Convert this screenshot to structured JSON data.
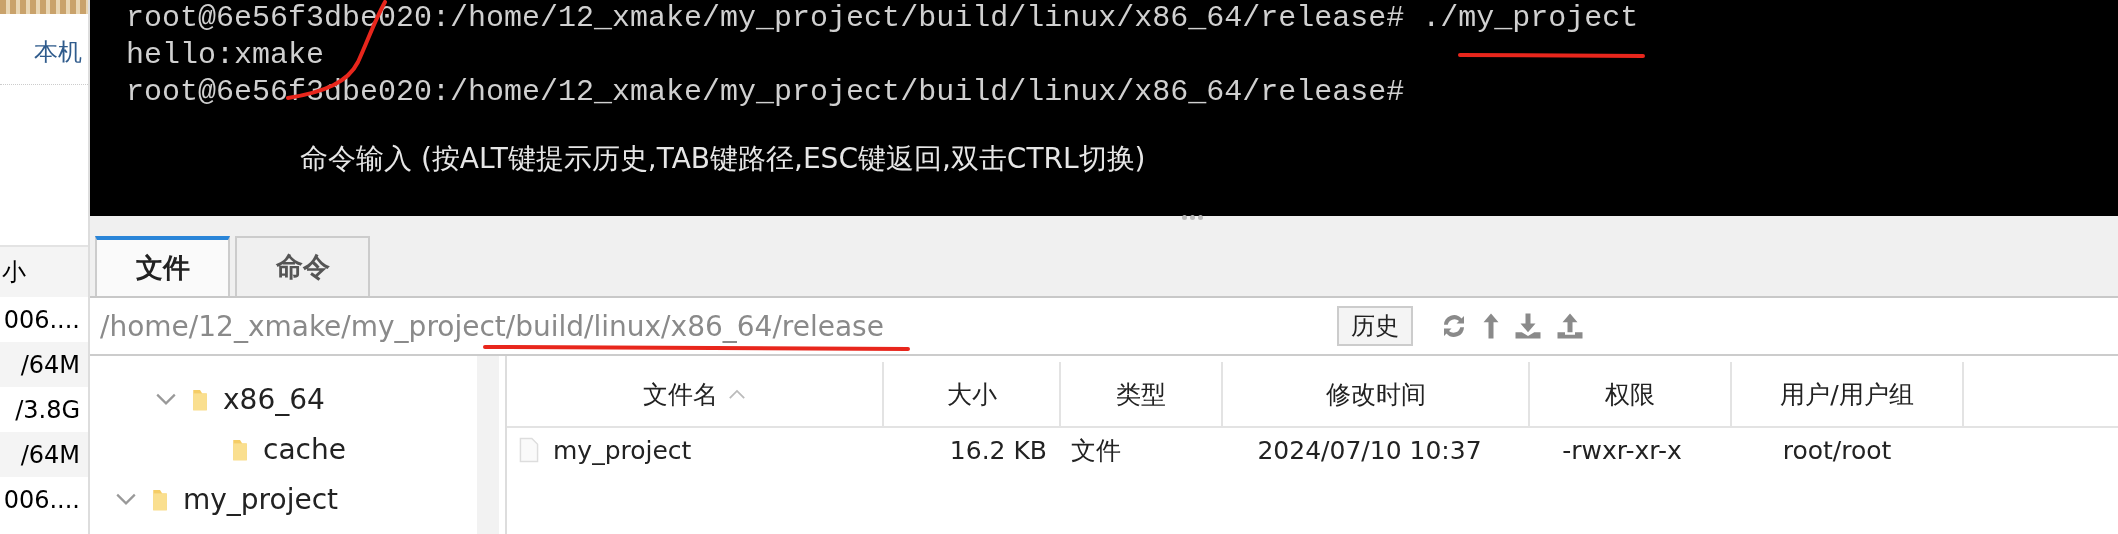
{
  "sidebar": {
    "location_label": "本机",
    "table_header": "小",
    "rows": [
      "006....",
      "/64M",
      "/3.8G",
      "/64M",
      "006...."
    ]
  },
  "terminal": {
    "lines": [
      {
        "kind": "prompt",
        "prompt": "root@6e56f3dbe020:/home/12_xmake/my_project/build/linux/x86_64/release#",
        "command": "./my_project"
      },
      {
        "kind": "output",
        "text": "hello:xmake"
      },
      {
        "kind": "prompt",
        "prompt": "root@6e56f3dbe020:/home/12_xmake/my_project/build/linux/x86_64/release#"
      }
    ],
    "hint": "命令输入 (按ALT键提示历史,TAB键路径,ESC键返回,双击CTRL切换)"
  },
  "tabs": [
    {
      "label": "文件",
      "selected": true
    },
    {
      "label": "命令",
      "selected": false
    }
  ],
  "path_bar": {
    "path": "/home/12_xmake/my_project/build/linux/x86_64/release",
    "history_button": "历史"
  },
  "tree": [
    {
      "children": [
        {
          "label": "x86_64",
          "expanded": true,
          "children": [
            {
              "label": "cache"
            }
          ]
        }
      ]
    },
    {
      "label": "my_project",
      "expanded": true
    }
  ],
  "file_table": {
    "columns": [
      "文件名",
      "大小",
      "类型",
      "修改时间",
      "权限",
      "用户/用户组"
    ],
    "rows": [
      {
        "name": "my_project",
        "size": "16.2 KB",
        "type": "文件",
        "modified": "2024/07/10 10:37",
        "permissions": "-rwxr-xr-x",
        "owner": "root/root"
      }
    ]
  }
}
